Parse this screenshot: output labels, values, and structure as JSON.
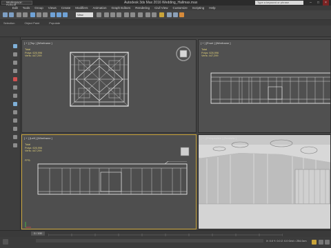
{
  "titlebar": {
    "workspace": "Workspace: Default",
    "title": "Autodesk 3ds Max 2016     Wedding_Hallmax.max",
    "search_placeholder": "Type a keyword or phrase"
  },
  "menu": [
    "Edit",
    "Tools",
    "Group",
    "Views",
    "Create",
    "Modifiers",
    "Animation",
    "Graph Editors",
    "Rendering",
    "Civil View",
    "Customize",
    "Scripting",
    "Help"
  ],
  "toolbar": {
    "view_select": "View"
  },
  "ribbon": [
    "Selection",
    "Object Paint",
    "Populate"
  ],
  "viewports": {
    "top": {
      "label": "[ + ] [Top ] [Wireframe ]",
      "stats": {
        "total": "Total",
        "polys": "Polys:   626,996",
        "verts": "Verts:   447,299"
      }
    },
    "front": {
      "label": "[ + ] [Front ] [Wireframe ]",
      "stats": {
        "total": "Total",
        "polys": "Polys:   626,996",
        "verts": "Verts:   447,299"
      }
    },
    "left": {
      "label": "[ + ] [Left ] [Wireframe ]",
      "stats": {
        "total": "Total",
        "polys": "Polys:   626,996",
        "verts": "Verts:   447,299"
      },
      "fps": "FPS:"
    },
    "perspective": {
      "label": "[ + ] [Perspective ] [Realistic ]"
    }
  },
  "timeline": {
    "frame": "0 / 100"
  },
  "statusbar": {
    "coords": "X: 0.0     Y: 0.0     Z: 0.0     Grid = 254.0cm"
  },
  "colors": {
    "active_viewport": "#c9a43a",
    "stats_text": "#e2d27a"
  }
}
